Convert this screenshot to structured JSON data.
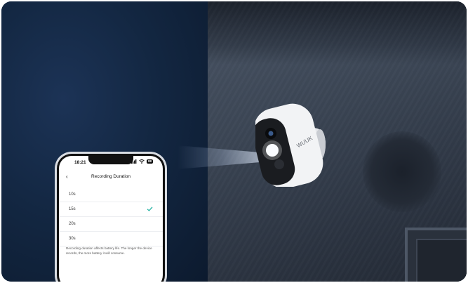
{
  "phone": {
    "time": "18:21",
    "battery": "88",
    "screen_title": "Recording Duration",
    "back_icon": "chevron-left-icon",
    "options": [
      {
        "label": "10s",
        "selected": false
      },
      {
        "label": "15s",
        "selected": true
      },
      {
        "label": "20s",
        "selected": false
      },
      {
        "label": "30s",
        "selected": false
      }
    ],
    "note": "Recording duration affects battery life. The longer the device records, the more battery it will consume."
  },
  "camera": {
    "brand": "WUUK"
  },
  "colors": {
    "accent_check": "#2bb5a6",
    "night_blue": "#132742"
  }
}
